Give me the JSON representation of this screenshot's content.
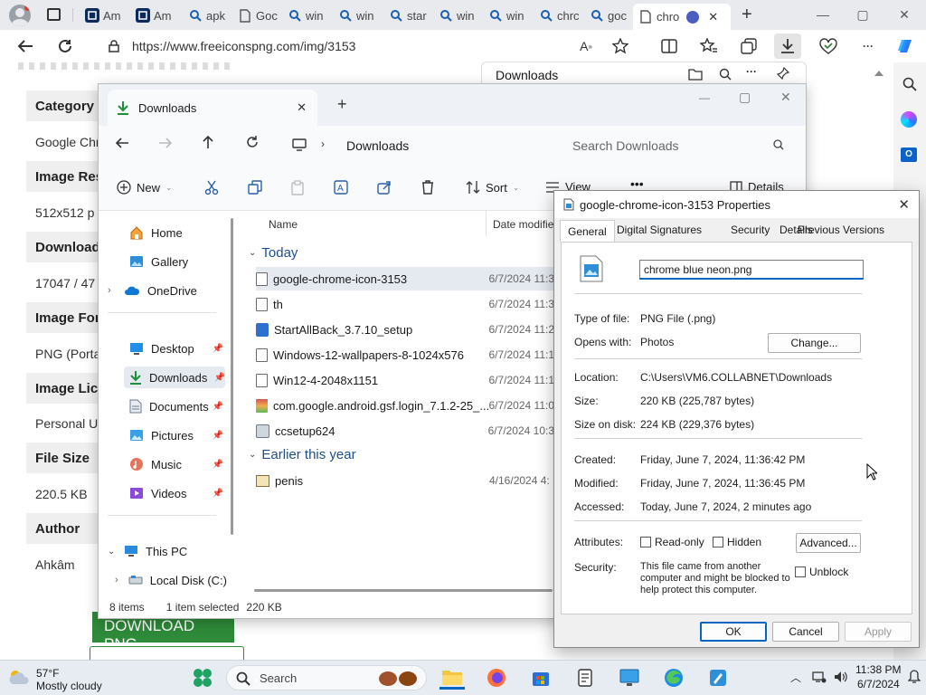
{
  "browser": {
    "tabs": [
      "Am",
      "Am",
      "apk",
      "Goc",
      "win",
      "win",
      "star",
      "win",
      "win",
      "chrc",
      "goc",
      "chro"
    ],
    "new_tab_label": "+",
    "url": "https://www.freeiconspng.com/img/3153",
    "window_controls": {
      "minimize": "—",
      "maximize": "▢",
      "close": "✕"
    }
  },
  "webpage": {
    "fields": [
      {
        "label": "Category",
        "value": "Google Chr"
      },
      {
        "label": "Image Res",
        "value": "512x512 p"
      },
      {
        "label": "Download",
        "value": "17047 / 47"
      },
      {
        "label": "Image For",
        "value": "PNG (Porta"
      },
      {
        "label": "Image Lice",
        "value": "Personal U"
      },
      {
        "label": "File Size",
        "value": "220.5 KB"
      },
      {
        "label": "Author",
        "value": "Ahkâm"
      }
    ],
    "download_button": "DOWNLOAD PNG"
  },
  "downloads_flyout": {
    "title": "Downloads"
  },
  "explorer": {
    "tab_title": "Downloads",
    "new_tab": "+",
    "breadcrumb": "Downloads",
    "search_placeholder": "Search Downloads",
    "commands": {
      "new": "New",
      "sort": "Sort",
      "view": "View",
      "details": "Details",
      "more": "•••"
    },
    "sidebar": {
      "home": "Home",
      "gallery": "Gallery",
      "onedrive": "OneDrive",
      "desktop": "Desktop",
      "downloads": "Downloads",
      "documents": "Documents",
      "pictures": "Pictures",
      "music": "Music",
      "videos": "Videos",
      "thispc": "This PC",
      "localdisk": "Local Disk (C:)"
    },
    "columns": {
      "name": "Name",
      "date": "Date modifie"
    },
    "groups": {
      "today": "Today",
      "earlier": "Earlier this year"
    },
    "files_today": [
      {
        "name": "google-chrome-icon-3153",
        "date": "6/7/2024 11:3"
      },
      {
        "name": "th",
        "date": "6/7/2024 11:3"
      },
      {
        "name": "StartAllBack_3.7.10_setup",
        "date": "6/7/2024 11:2"
      },
      {
        "name": "Windows-12-wallpapers-8-1024x576",
        "date": "6/7/2024 11:1"
      },
      {
        "name": "Win12-4-2048x1151",
        "date": "6/7/2024 11:1"
      },
      {
        "name": "com.google.android.gsf.login_7.1.2-25_...",
        "date": "6/7/2024 11:0"
      },
      {
        "name": "ccsetup624",
        "date": "6/7/2024 10:3"
      }
    ],
    "files_earlier": [
      {
        "name": "penis",
        "date": "4/16/2024 4:"
      }
    ],
    "status": {
      "count": "8 items",
      "selected": "1 item selected",
      "size": "220 KB"
    }
  },
  "properties": {
    "title": "google-chrome-icon-3153 Properties",
    "tabs": [
      "General",
      "Digital Signatures",
      "Security",
      "Details",
      "Previous Versions"
    ],
    "filename": "chrome blue neon.png",
    "type_label": "Type of file:",
    "type_value": "PNG File (.png)",
    "opens_label": "Opens with:",
    "opens_value": "Photos",
    "change_btn": "Change...",
    "location_label": "Location:",
    "location_value": "C:\\Users\\VM6.COLLABNET\\Downloads",
    "size_label": "Size:",
    "size_value": "220 KB (225,787 bytes)",
    "sod_label": "Size on disk:",
    "sod_value": "224 KB (229,376 bytes)",
    "created_label": "Created:",
    "created_value": "Friday, June 7, 2024, 11:36:42 PM",
    "modified_label": "Modified:",
    "modified_value": "Friday, June 7, 2024, 11:36:45 PM",
    "accessed_label": "Accessed:",
    "accessed_value": "Today, June 7, 2024, 2 minutes ago",
    "attributes_label": "Attributes:",
    "readonly": "Read-only",
    "hidden": "Hidden",
    "advanced_btn": "Advanced...",
    "security_label": "Security:",
    "security_text_1": "This file came from another",
    "security_text_2": "computer and might be blocked to",
    "security_text_3": "help protect this computer.",
    "unblock": "Unblock",
    "ok": "OK",
    "cancel": "Cancel",
    "apply": "Apply"
  },
  "taskbar": {
    "weather_temp": "57°F",
    "weather_desc": "Mostly cloudy",
    "search_placeholder": "Search",
    "time": "11:38 PM",
    "date": "6/7/2024"
  },
  "colors": {
    "accent": "#0067c0",
    "download_green": "#2e8b3a",
    "selection": "#e5eaf1"
  }
}
